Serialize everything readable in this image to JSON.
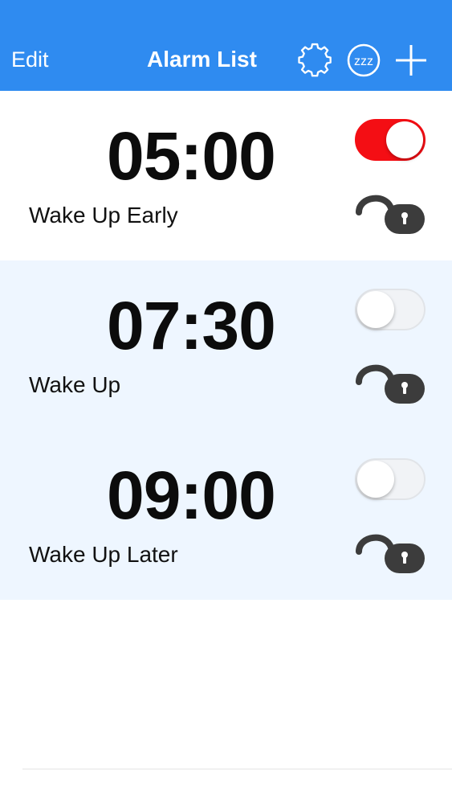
{
  "nav": {
    "edit_label": "Edit",
    "title": "Alarm List",
    "icons": [
      "gear-icon",
      "snooze-icon",
      "plus-icon"
    ],
    "snooze_glyph": "zzz",
    "color": "#2f8bf0"
  },
  "alarms": [
    {
      "time": "05:00",
      "label": "Wake Up Early",
      "enabled": true,
      "background": "#ffffff"
    },
    {
      "time": "07:30",
      "label": "Wake Up",
      "enabled": false,
      "background": "#eef6ff"
    },
    {
      "time": "09:00",
      "label": "Wake Up Later",
      "enabled": false,
      "background": "#eef6ff"
    }
  ],
  "colors": {
    "toggle_on": "#f40e14",
    "toggle_off": "#f1f3f6",
    "lock_icon": "#3c3c3c",
    "row_alt": "#eef6ff"
  }
}
